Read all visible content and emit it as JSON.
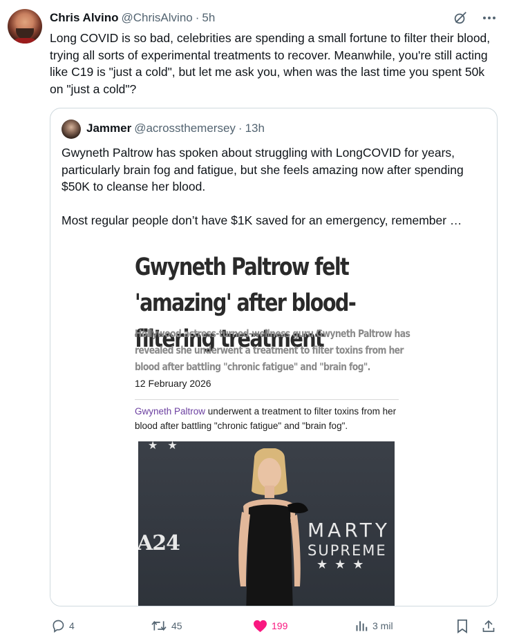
{
  "post": {
    "author_name": "Chris Alvino",
    "author_handle": "@ChrisAlvino",
    "separator": "·",
    "time": "5h",
    "text": "Long COVID is so bad, celebrities are spending a small fortune to filter their blood, trying all sorts of experimental treatments to recover. Meanwhile, you're still acting like C19 is \"just a cold\", but let me ask you, when was the last time you spent 50k on \"just a cold\"?"
  },
  "quote": {
    "author_name": "Jammer",
    "author_handle": "@acrossthemersey",
    "separator": "·",
    "time": "13h",
    "text": "Gwyneth Paltrow has spoken about struggling with LongCOVID for years, particularly brain fog and fatigue, but she feels amazing now after spending $50K to cleanse her blood.\n\nMost regular people don’t have $1K saved for an emergency, remember …"
  },
  "article": {
    "headline": "Gwyneth Paltrow felt 'amazing' after blood-filtering treatment",
    "subheadline": "Hollywood actress-turned-wellness guru Gwyneth Paltrow has revealed she underwent a treatment to filter toxins from her blood after battling \"chronic fatigue\" and \"brain fog\".",
    "date": "12 February 2026",
    "caption_link": "Gwyneth Paltrow",
    "caption_rest": " underwent a treatment to filter toxins from her blood after battling \"chronic fatigue\" and \"brain fog\".",
    "photo_logo": "A24",
    "photo_title_1": "MARTY",
    "photo_title_2": "SUPREME",
    "photo_stars_top": "★★",
    "photo_stars_bottom": "★★★"
  },
  "actions": {
    "replies": "4",
    "reposts": "45",
    "likes": "199",
    "views": "3 mil"
  },
  "icons": {
    "grok": "grok-icon",
    "more": "more-icon",
    "reply": "reply-icon",
    "repost": "repost-icon",
    "like": "heart-icon",
    "views": "views-icon",
    "bookmark": "bookmark-icon",
    "share": "share-icon"
  },
  "colors": {
    "like_active": "#f91880",
    "secondary_text": "#536471",
    "border": "#cfd9de",
    "caption_link": "#6b3fa0"
  }
}
